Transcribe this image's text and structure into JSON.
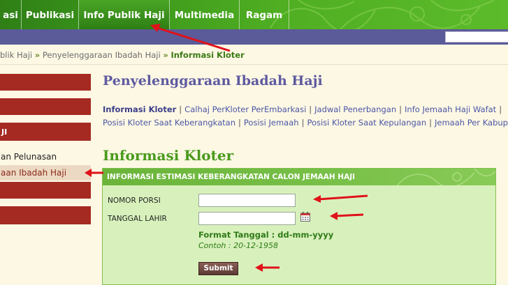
{
  "nav": {
    "items": [
      {
        "label": "asi"
      },
      {
        "label": "Publikasi"
      },
      {
        "label": "Info Publik Haji"
      },
      {
        "label": "Multimedia"
      },
      {
        "label": "Ragam"
      }
    ]
  },
  "breadcrumb": {
    "item1": "blik Haji",
    "sep": "»",
    "item2": "Penyelenggaraan Ibadah Haji",
    "current": "Informasi Kloter"
  },
  "sidebar": {
    "block3": "JI",
    "links": [
      {
        "label": "an Pelunasan"
      },
      {
        "label": "aan Ibadah Haji"
      }
    ]
  },
  "main": {
    "section_title": "Penyelenggaraan Ibadah Haji",
    "links_row1": [
      "Informasi Kloter",
      "Calhaj PerKloter PerEmbarkasi",
      "Jadwal Penerbangan",
      "Info Jemaah Haji Wafat"
    ],
    "links_row2": [
      "Posisi Kloter Saat Keberangkatan",
      "Posisi Jemaah",
      "Posisi Kloter Saat Kepulangan",
      "Jemaah Per Kabupa"
    ],
    "pipe": "|",
    "kloter_title": "Informasi Kloter",
    "form": {
      "header": "INFORMASI ESTIMASI KEBERANGKATAN CALON JEMAAH HAJI",
      "nomor_porsi_label": "NOMOR PORSI",
      "nomor_porsi_value": "",
      "tanggal_lahir_label": "TANGGAL LAHIR",
      "tanggal_lahir_value": "",
      "format": "Format Tanggal : dd-mm-yyyy",
      "example": "Contoh : 20-12-1958",
      "submit": "Submit"
    }
  },
  "colors": {
    "nav_green": "#3d9a1c",
    "purple_bar": "#5b5b9a",
    "sidebar_red": "#a52a22",
    "annotation_red": "#e0121a"
  },
  "icons": {
    "calendar": "calendar-icon"
  }
}
